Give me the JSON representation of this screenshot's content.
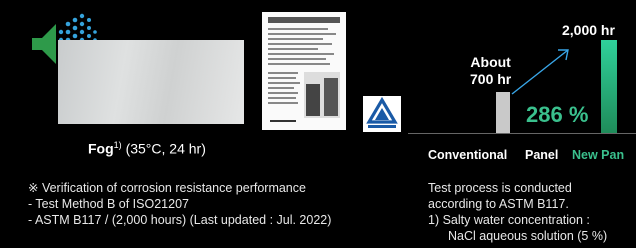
{
  "fog": {
    "label_bold": "Fog",
    "footnote": "1)",
    "condition": "(35°C, 24 hr)"
  },
  "chart_data": {
    "type": "bar",
    "categories": [
      "Conventional",
      "New Panel"
    ],
    "values": [
      700,
      2000
    ],
    "value_labels": [
      "About\n700 hr",
      "2,000 hr"
    ],
    "improvement": "286 %",
    "category_labels": {
      "conventional": "Conventional",
      "panel": "Panel",
      "new": "New Pan"
    },
    "colors": {
      "conventional": "#c9c9c9",
      "new": "#2cb87e",
      "accent": "#3ac08d"
    }
  },
  "notes": {
    "line1": "※ Verification of corrosion resistance performance",
    "line2": "- Test Method B of ISO21207",
    "line3": "- ASTM B117 / (2,000 hours) (Last updated : Jul. 2022)"
  },
  "process": {
    "line1": "Test process is conducted",
    "line2": "according to ASTM B117.",
    "line3": "1) Salty water concentration :",
    "line4": "NaCl aqueous solution (5 %)"
  },
  "icons": {
    "speaker": "speaker-icon",
    "cert": "certificate-document",
    "tuv": "tuv-logo"
  }
}
